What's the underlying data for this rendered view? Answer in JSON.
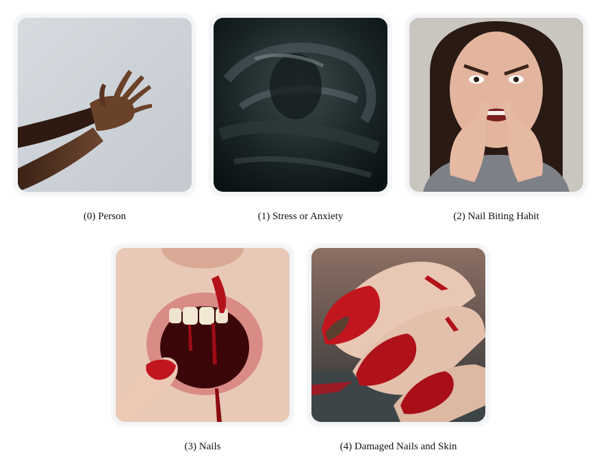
{
  "panels": [
    {
      "caption": "(0) Person",
      "image": "reaching-hands"
    },
    {
      "caption": "(1) Stress or Anxiety",
      "image": "dark-abstract-painting"
    },
    {
      "caption": "(2) Nail Biting Habit",
      "image": "stressed-woman"
    },
    {
      "caption": "(3) Nails",
      "image": "bleeding-mouth"
    },
    {
      "caption": "(4) Damaged Nails and Skin",
      "image": "bloody-nails"
    }
  ],
  "colors": {
    "background": "#ffffff",
    "card": "#f3f4f6",
    "blood": "#b3121b",
    "dark": "#0f1a1c"
  }
}
